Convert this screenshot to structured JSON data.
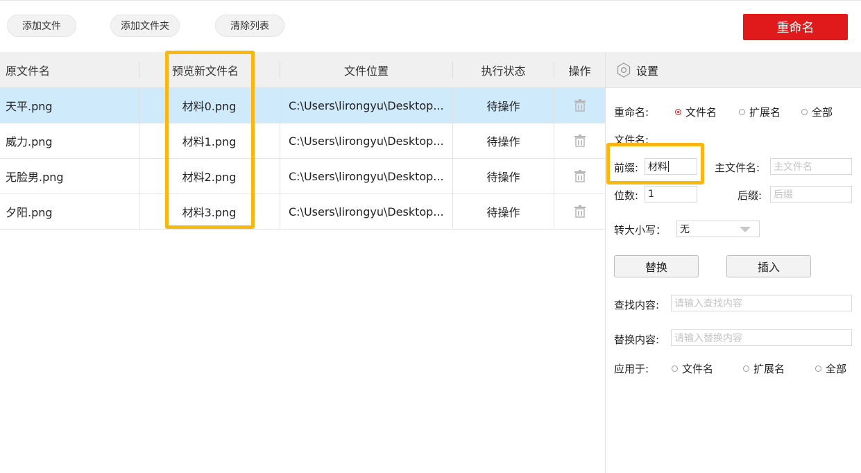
{
  "toolbar": {
    "add_file": "添加文件",
    "add_folder": "添加文件夹",
    "clear_list": "清除列表",
    "rename": "重命名"
  },
  "table": {
    "headers": [
      "原文件名",
      "预览新文件名",
      "文件位置",
      "执行状态",
      "操作"
    ],
    "rows": [
      {
        "original": "天平.png",
        "preview": "材料0.png",
        "location": "C:\\Users\\lirongyu\\Desktop...",
        "status": "待操作"
      },
      {
        "original": "威力.png",
        "preview": "材料1.png",
        "location": "C:\\Users\\lirongyu\\Desktop...",
        "status": "待操作"
      },
      {
        "original": "无脸男.png",
        "preview": "材料2.png",
        "location": "C:\\Users\\lirongyu\\Desktop...",
        "status": "待操作"
      },
      {
        "original": "夕阳.png",
        "preview": "材料3.png",
        "location": "C:\\Users\\lirongyu\\Desktop...",
        "status": "待操作"
      }
    ]
  },
  "settings": {
    "title": "设置",
    "rename_label": "重命名:",
    "rename_options": [
      "文件名",
      "扩展名",
      "全部"
    ],
    "filename_label": "文件名:",
    "prefix_label": "前缀:",
    "prefix_value": "材料",
    "main_name_label": "主文件名:",
    "main_name_placeholder": "主文件名",
    "digits_label": "位数:",
    "digits_value": "1",
    "suffix_label": "后缀:",
    "suffix_placeholder": "后缀",
    "case_label": "转大小写：",
    "case_value": "无",
    "replace_button": "替换",
    "insert_button": "插入",
    "find_label": "查找内容:",
    "find_placeholder": "请输入查找内容",
    "replace_label": "替换内容:",
    "replace_placeholder": "请输入替换内容",
    "apply_label": "应用于:",
    "apply_options": [
      "文件名",
      "扩展名",
      "全部"
    ]
  },
  "colors": {
    "accent_red": "#e0191b",
    "highlight_yellow": "#fbb711",
    "selected_row": "#cfeafb"
  }
}
